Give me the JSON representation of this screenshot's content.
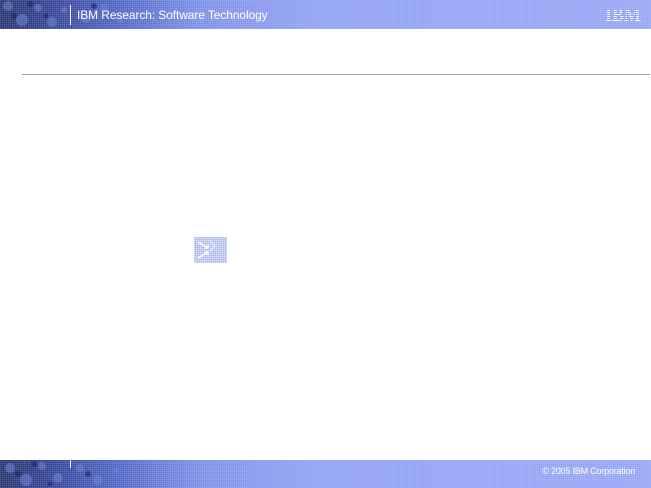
{
  "header": {
    "title": "IBM Research: Software Technology",
    "logo_text": "IBM"
  },
  "footer": {
    "copyright": "© 2005 IBM Corporation"
  },
  "slide": {
    "graphic": "arrow-graphic-icon"
  },
  "colors": {
    "header_dark": "#24306e",
    "header_light": "#94a4f4",
    "rule": "#a89aa8",
    "text_on_bar": "#ffffff"
  }
}
